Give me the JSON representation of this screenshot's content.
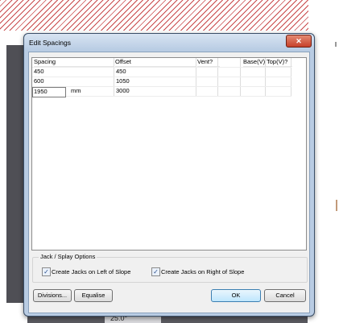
{
  "dialog": {
    "title": "Edit Spacings",
    "close_label": "✕"
  },
  "grid": {
    "columns": [
      "Spacing",
      "Offset",
      "Vent?",
      "Base(V)",
      "Top(V)?"
    ],
    "rows": [
      {
        "spacing": "450",
        "offset": "450"
      },
      {
        "spacing": "600",
        "offset": "1050"
      },
      {
        "spacing": "1950",
        "unit": "mm",
        "offset": "3000"
      }
    ]
  },
  "options": {
    "group_label": "Jack / Splay Options",
    "left_label": "Create Jacks on Left of Slope",
    "left_checked": true,
    "right_label": "Create Jacks on Right of Slope",
    "right_checked": true
  },
  "buttons": {
    "divisions": "Divisions...",
    "equalise": "Equalise",
    "ok": "OK",
    "cancel": "Cancel"
  },
  "background": {
    "angle_text": "25.0°"
  },
  "colors": {
    "hatch": "#c8484a",
    "frame": "#b9cce3",
    "close": "#c7412a"
  }
}
